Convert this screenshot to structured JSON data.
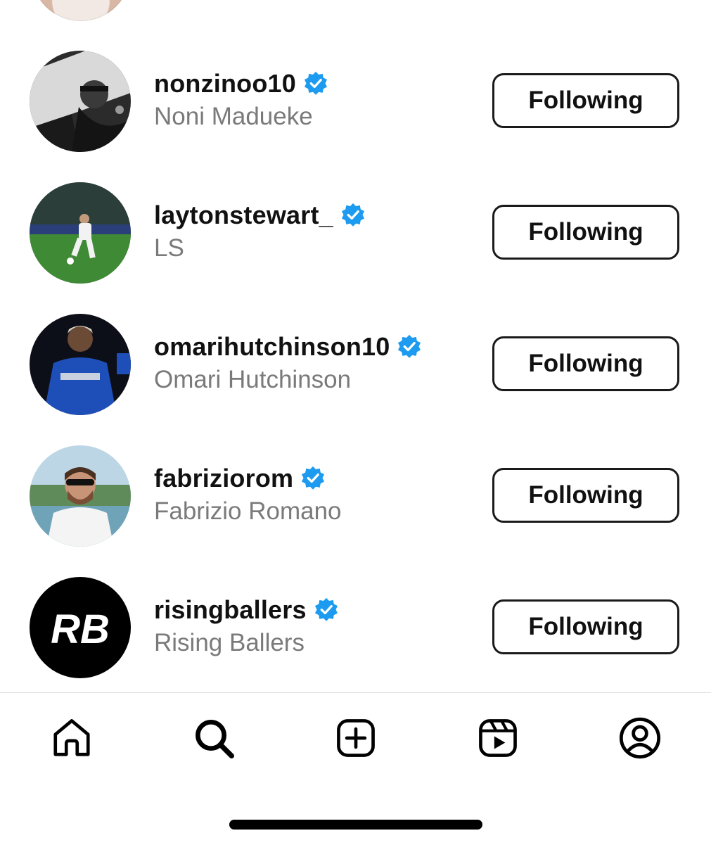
{
  "accounts": [
    {
      "username": "nonzinoo10",
      "full_name": "Noni Madueke",
      "verified": true,
      "button_label": "Following"
    },
    {
      "username": "laytonstewart_",
      "full_name": "LS",
      "verified": true,
      "button_label": "Following"
    },
    {
      "username": "omarihutchinson10",
      "full_name": "Omari Hutchinson",
      "verified": true,
      "button_label": "Following"
    },
    {
      "username": "fabriziorom",
      "full_name": "Fabrizio Romano",
      "verified": true,
      "button_label": "Following"
    },
    {
      "username": "risingballers",
      "full_name": "Rising Ballers",
      "verified": true,
      "button_label": "Following"
    }
  ],
  "avatar_logo_text": "RB",
  "colors": {
    "verified_badge": "#1d9bf0",
    "secondary_text": "#7a7a7a",
    "button_border": "#1a1a1a"
  },
  "tab_bar": {
    "tabs": [
      {
        "icon": "home-icon"
      },
      {
        "icon": "search-icon"
      },
      {
        "icon": "create-post-icon"
      },
      {
        "icon": "reels-icon"
      },
      {
        "icon": "profile-icon"
      }
    ]
  }
}
